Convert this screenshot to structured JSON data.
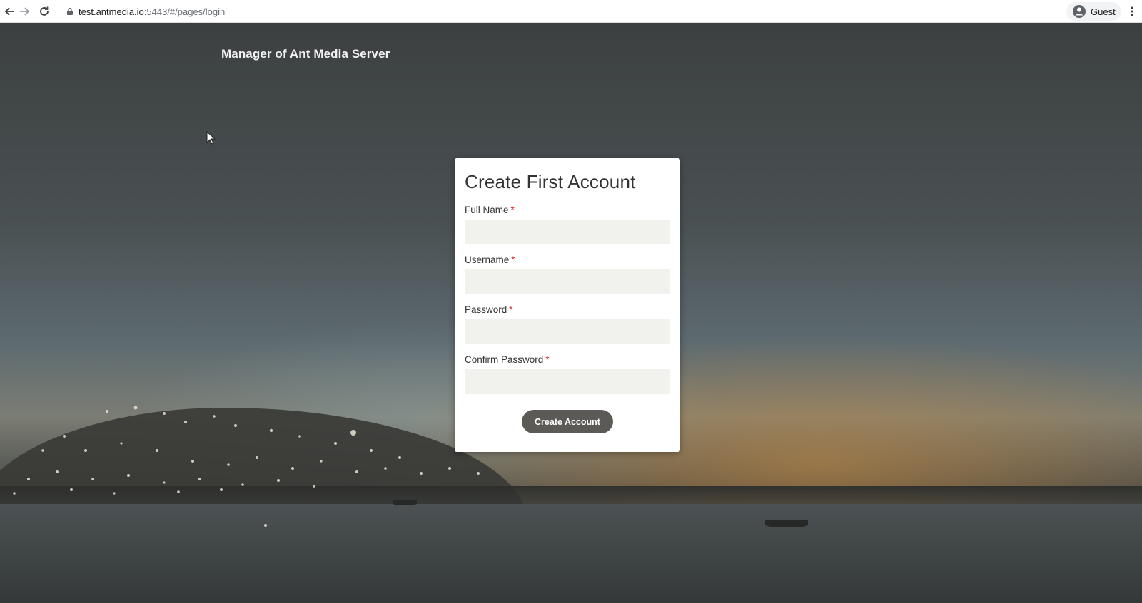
{
  "browser": {
    "url_host": "test.antmedia.io",
    "url_path": ":5443/#/pages/login",
    "profile_label": "Guest"
  },
  "header": {
    "brand_title": "Manager of Ant Media Server"
  },
  "form": {
    "title": "Create First Account",
    "required_marker": "*",
    "fields": [
      {
        "label": "Full Name",
        "value": ""
      },
      {
        "label": "Username",
        "value": ""
      },
      {
        "label": "Password",
        "value": ""
      },
      {
        "label": "Confirm Password",
        "value": ""
      }
    ],
    "submit_label": "Create Account"
  },
  "colors": {
    "button_bg": "#5b5a56",
    "required": "#e0262f",
    "input_bg": "#f1f1ee"
  }
}
